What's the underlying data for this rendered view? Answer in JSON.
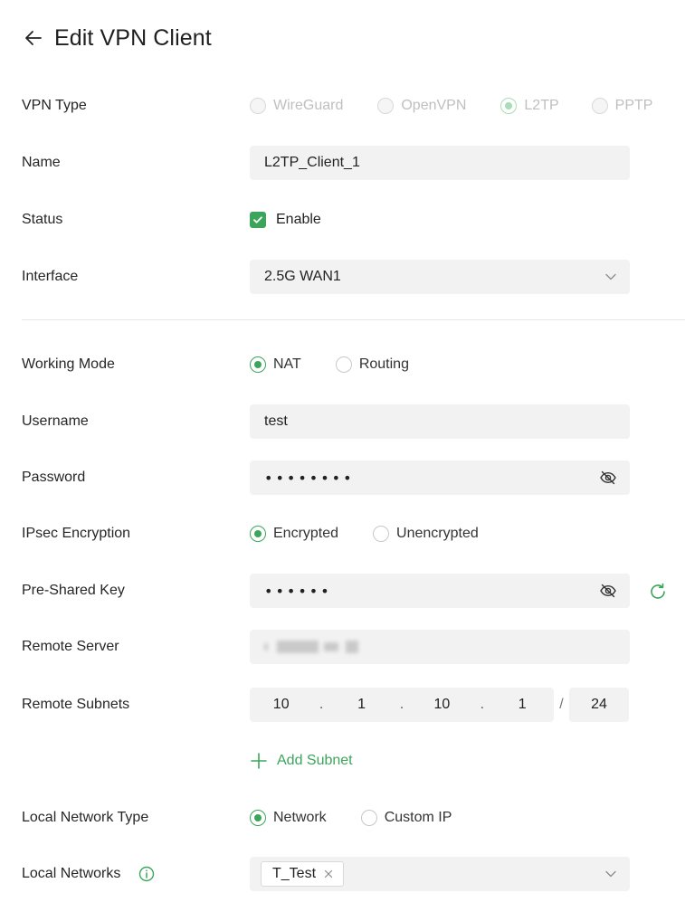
{
  "header": {
    "title": "Edit VPN Client",
    "back_icon": "arrow-left-icon"
  },
  "colors": {
    "accent": "#3ca55c",
    "field_bg": "#f2f2f2",
    "divider": "#e6e6e6"
  },
  "vpn_type": {
    "label": "VPN Type",
    "options": [
      "WireGuard",
      "OpenVPN",
      "L2TP",
      "PPTP"
    ],
    "selected": "L2TP",
    "disabled": true
  },
  "name": {
    "label": "Name",
    "value": "L2TP_Client_1"
  },
  "status": {
    "label": "Status",
    "checkbox_label": "Enable",
    "checked": true
  },
  "interface": {
    "label": "Interface",
    "value": "2.5G WAN1"
  },
  "working_mode": {
    "label": "Working Mode",
    "options": [
      "NAT",
      "Routing"
    ],
    "selected": "NAT"
  },
  "username": {
    "label": "Username",
    "value": "test"
  },
  "password": {
    "label": "Password",
    "masked": "••••••••"
  },
  "ipsec": {
    "label": "IPsec Encryption",
    "options": [
      "Encrypted",
      "Unencrypted"
    ],
    "selected": "Encrypted"
  },
  "psk": {
    "label": "Pre-Shared Key",
    "masked": "••••••"
  },
  "remote_server": {
    "label": "Remote Server"
  },
  "remote_subnets": {
    "label": "Remote Subnets",
    "octets": [
      "10",
      "1",
      "10",
      "1"
    ],
    "mask": "24",
    "dot": ".",
    "slash": "/"
  },
  "add_subnet": {
    "label": "Add Subnet"
  },
  "local_network_type": {
    "label": "Local Network Type",
    "options": [
      "Network",
      "Custom IP"
    ],
    "selected": "Network"
  },
  "local_networks": {
    "label": "Local Networks",
    "tags": [
      "T_Test"
    ]
  }
}
